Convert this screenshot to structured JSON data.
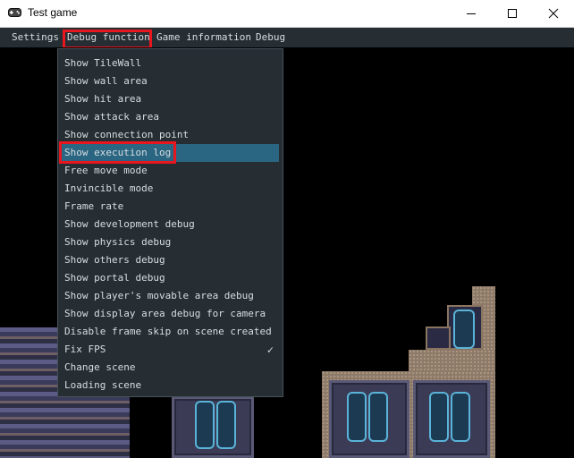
{
  "window": {
    "title": "Test game",
    "icon": "gamepad-icon"
  },
  "window_controls": {
    "minimize": "minimize-icon",
    "maximize": "maximize-icon",
    "close": "close-icon"
  },
  "menubar": {
    "items": [
      "Settings",
      "Debug function",
      "Game information",
      "Debug"
    ]
  },
  "dropdown": {
    "items": [
      {
        "label": "Show TileWall"
      },
      {
        "label": "Show wall area"
      },
      {
        "label": "Show hit area"
      },
      {
        "label": "Show attack area"
      },
      {
        "label": "Show connection point"
      },
      {
        "label": "Show execution log"
      },
      {
        "label": "Free move mode"
      },
      {
        "label": "Invincible mode"
      },
      {
        "label": "Frame rate"
      },
      {
        "label": "Show development debug"
      },
      {
        "label": "Show physics debug"
      },
      {
        "label": "Show others debug"
      },
      {
        "label": "Show portal debug"
      },
      {
        "label": "Show player's movable area debug"
      },
      {
        "label": "Show display area debug for camera"
      },
      {
        "label": "Disable frame skip on scene created"
      },
      {
        "label": "Fix FPS",
        "checked": true
      },
      {
        "label": "Change scene"
      },
      {
        "label": "Loading scene"
      }
    ],
    "highlighted": "Show execution log",
    "check_glyph": "✓"
  },
  "colors": {
    "menu_bg": "#262e33",
    "highlight": "#2a6581",
    "annotation_red": "#e8171f"
  }
}
